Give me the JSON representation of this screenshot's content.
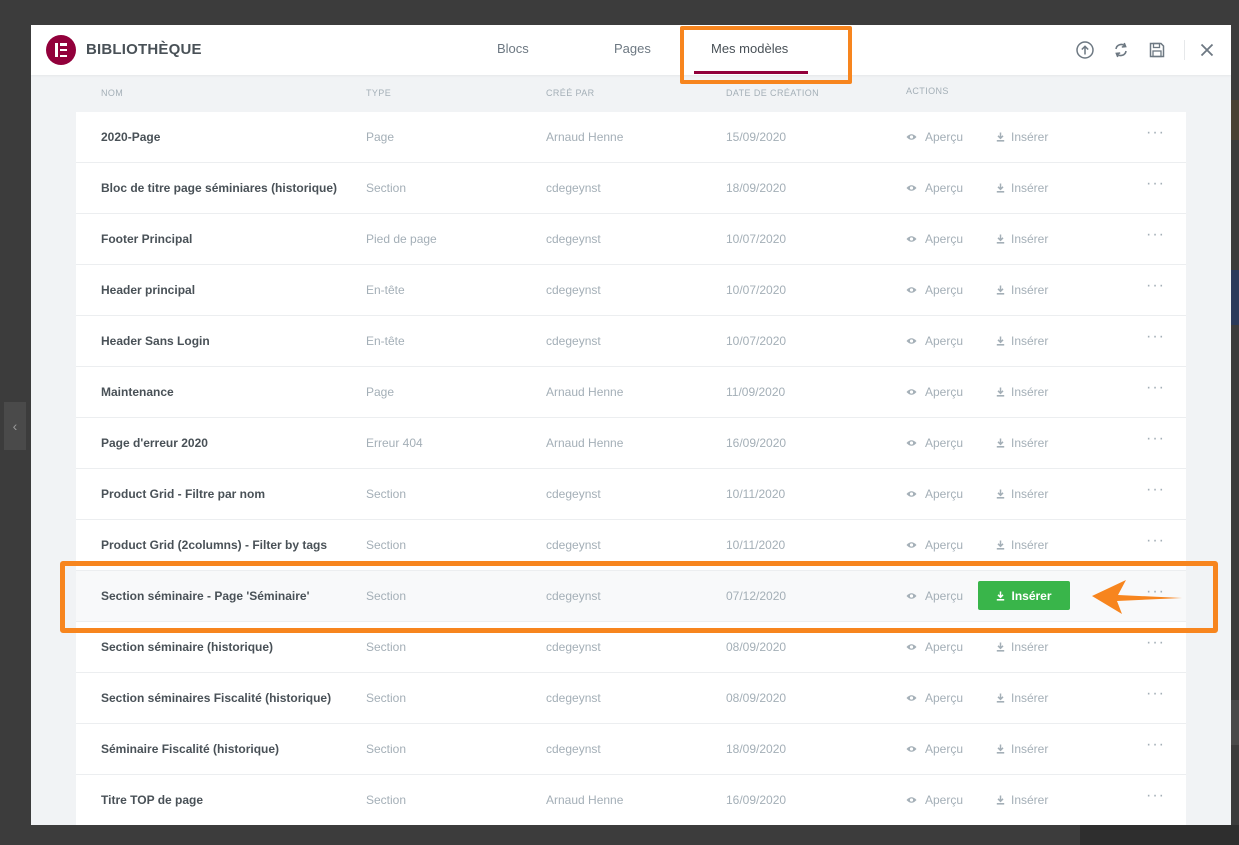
{
  "library": {
    "title": "BIBLIOTHÈQUE",
    "tabs": [
      {
        "label": "Blocs",
        "active": false
      },
      {
        "label": "Pages",
        "active": false
      },
      {
        "label": "Mes modèles",
        "active": true
      }
    ],
    "header_icons": [
      "upload-icon",
      "sync-icon",
      "save-icon",
      "close-icon"
    ]
  },
  "columns": {
    "name": "NOM",
    "type": "TYPE",
    "author": "CRÉÉ PAR",
    "date": "DATE DE CRÉATION",
    "actions": "ACTIONS"
  },
  "actions": {
    "preview_label": "Aperçu",
    "insert_label": "Insérer",
    "more_label": "···"
  },
  "templates": [
    {
      "name": "2020-Page",
      "type": "Page",
      "author": "Arnaud Henne",
      "date": "15/09/2020"
    },
    {
      "name": "Bloc de titre page séminiares (historique)",
      "type": "Section",
      "author": "cdegeynst",
      "date": "18/09/2020"
    },
    {
      "name": "Footer Principal",
      "type": "Pied de page",
      "author": "cdegeynst",
      "date": "10/07/2020"
    },
    {
      "name": "Header principal",
      "type": "En-tête",
      "author": "cdegeynst",
      "date": "10/07/2020"
    },
    {
      "name": "Header Sans Login",
      "type": "En-tête",
      "author": "cdegeynst",
      "date": "10/07/2020"
    },
    {
      "name": "Maintenance",
      "type": "Page",
      "author": "Arnaud Henne",
      "date": "11/09/2020"
    },
    {
      "name": "Page d'erreur 2020",
      "type": "Erreur 404",
      "author": "Arnaud Henne",
      "date": "16/09/2020"
    },
    {
      "name": "Product Grid - Filtre par nom",
      "type": "Section",
      "author": "cdegeynst",
      "date": "10/11/2020"
    },
    {
      "name": "Product Grid (2columns) - Filter by tags",
      "type": "Section",
      "author": "cdegeynst",
      "date": "10/11/2020"
    },
    {
      "name": "Section séminaire - Page 'Séminaire'",
      "type": "Section",
      "author": "cdegeynst",
      "date": "07/12/2020",
      "hovered": true
    },
    {
      "name": "Section séminaire (historique)",
      "type": "Section",
      "author": "cdegeynst",
      "date": "08/09/2020"
    },
    {
      "name": "Section séminaires Fiscalité (historique)",
      "type": "Section",
      "author": "cdegeynst",
      "date": "08/09/2020"
    },
    {
      "name": "Séminaire Fiscalité (historique)",
      "type": "Section",
      "author": "cdegeynst",
      "date": "18/09/2020"
    },
    {
      "name": "Titre TOP de page",
      "type": "Section",
      "author": "Arnaud Henne",
      "date": "16/09/2020"
    }
  ],
  "colors": {
    "brand": "#92003b",
    "insert_button": "#39b54a",
    "annotation": "#f7851e"
  }
}
